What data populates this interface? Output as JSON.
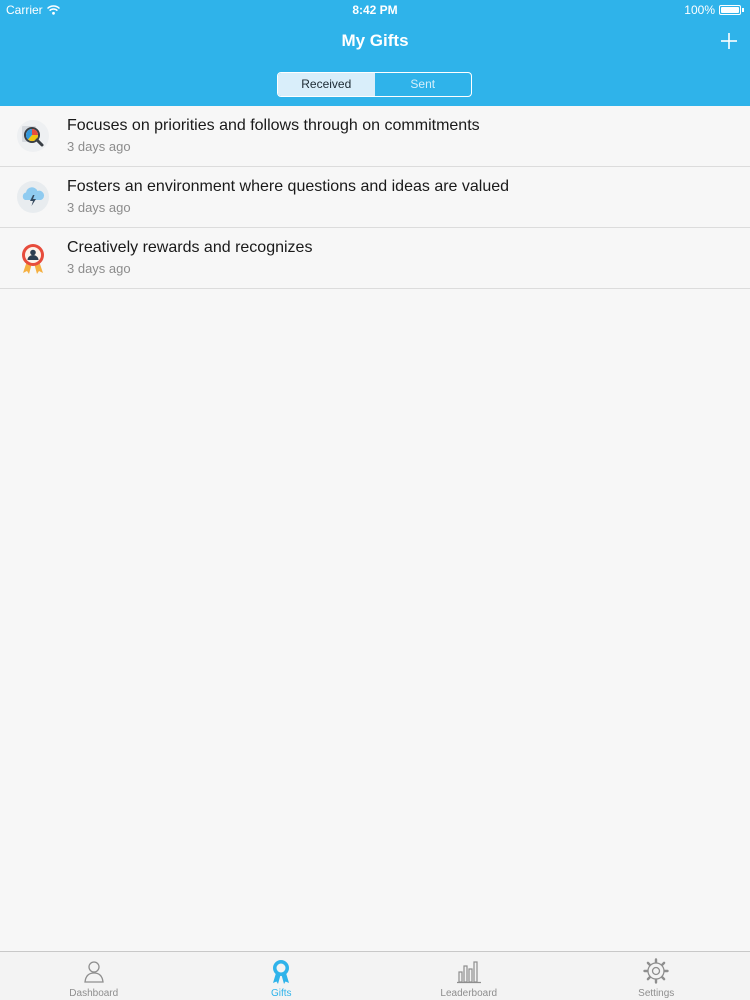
{
  "status_bar": {
    "carrier": "Carrier",
    "time": "8:42 PM",
    "battery": "100%"
  },
  "nav": {
    "title": "My Gifts",
    "add_icon": "plus-icon"
  },
  "segments": [
    {
      "label": "Received",
      "selected": true
    },
    {
      "label": "Sent",
      "selected": false
    }
  ],
  "gifts": [
    {
      "title": "Focuses on priorities and follows through on commitments",
      "time": "3 days ago",
      "icon": "magnifier-chart-icon"
    },
    {
      "title": "Fosters an environment where questions and ideas are valued",
      "time": "3 days ago",
      "icon": "cloud-lightning-icon"
    },
    {
      "title": "Creatively rewards and recognizes",
      "time": "3 days ago",
      "icon": "award-ribbon-icon"
    }
  ],
  "tabs": [
    {
      "label": "Dashboard",
      "icon": "person-icon",
      "active": false
    },
    {
      "label": "Gifts",
      "icon": "award-icon",
      "active": true
    },
    {
      "label": "Leaderboard",
      "icon": "bar-chart-icon",
      "active": false
    },
    {
      "label": "Settings",
      "icon": "gear-icon",
      "active": false
    }
  ],
  "colors": {
    "accent": "#2fb3ea",
    "background": "#f7f7f7",
    "tab_inactive": "#8e8e8e"
  }
}
